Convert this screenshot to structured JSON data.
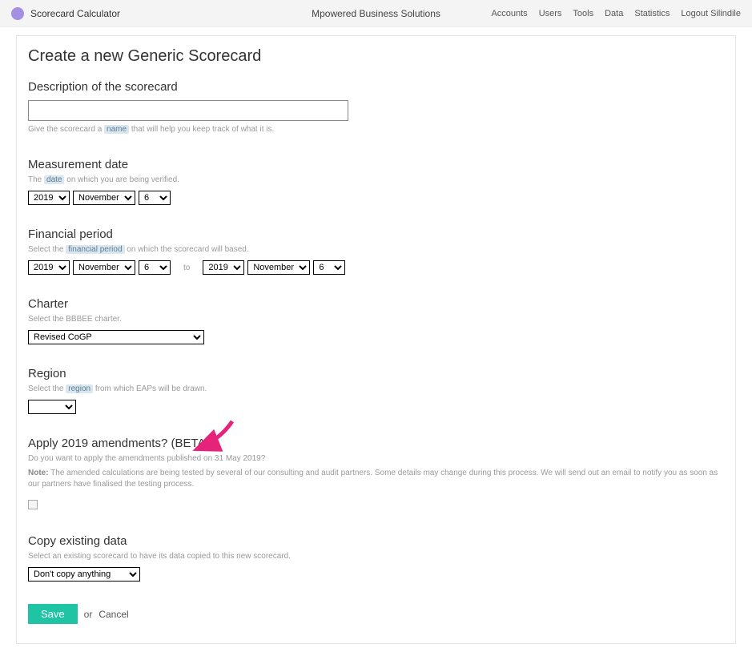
{
  "header": {
    "app_title": "Scorecard Calculator",
    "brand": "Mpowered Business Solutions",
    "nav": [
      "Accounts",
      "Users",
      "Tools",
      "Data",
      "Statistics",
      "Logout Silindile"
    ]
  },
  "page_title": "Create a new Generic Scorecard",
  "description": {
    "label": "Description of the scorecard",
    "value": "",
    "help_pre": "Give the scorecard a ",
    "help_tag": "name",
    "help_post": " that will help you keep track of what it is."
  },
  "measurement": {
    "label": "Measurement date",
    "help_pre": "The ",
    "help_tag": "date",
    "help_post": " on which you are being verified.",
    "year": "2019",
    "month": "November",
    "day": "6"
  },
  "financial": {
    "label": "Financial period",
    "help_pre": "Select the ",
    "help_tag": "financial period",
    "help_post": " on which the scorecard will based.",
    "from": {
      "year": "2019",
      "month": "November",
      "day": "6"
    },
    "to_word": "to",
    "to": {
      "year": "2019",
      "month": "November",
      "day": "6"
    }
  },
  "charter": {
    "label": "Charter",
    "help": "Select the BBBEE charter.",
    "value": "Revised CoGP"
  },
  "region": {
    "label": "Region",
    "help_pre": "Select the ",
    "help_tag": "region",
    "help_post": " from which EAPs will be drawn.",
    "value": ""
  },
  "amendments": {
    "label": "Apply 2019 amendments? (BETA)",
    "help1": "Do you want to apply the amendments published on 31 May 2019?",
    "note_label": "Note:",
    "note_text": " The amended calculations are being tested by several of our consulting and audit partners. Some details may change during this process. We will send out an email to notify you as soon as our partners have finalised the testing process.",
    "checked": false
  },
  "copy": {
    "label": "Copy existing data",
    "help": "Select an existing scorecard to have its data copied to this new scorecard.",
    "value": "Don't copy anything"
  },
  "actions": {
    "save": "Save",
    "or": "or",
    "cancel": "Cancel"
  }
}
